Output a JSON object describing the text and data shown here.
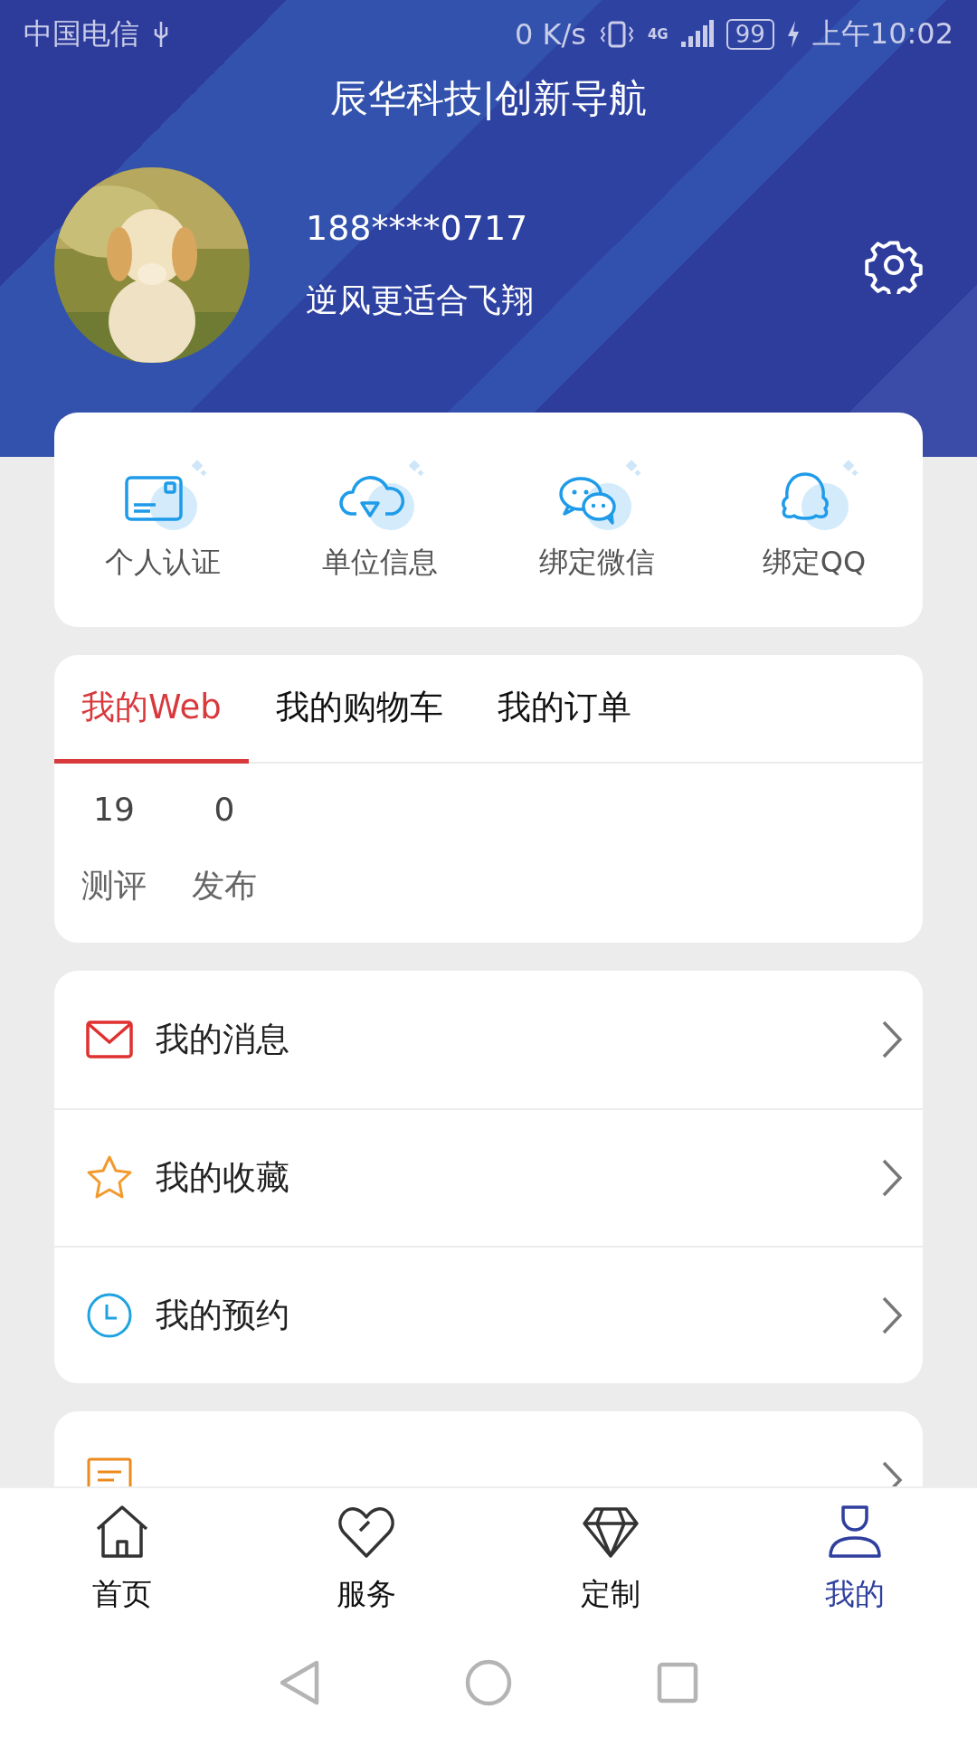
{
  "status_bar": {
    "carrier": "中国电信",
    "speed": "0 K/s",
    "network": "4G",
    "battery": "99",
    "time": "上午10:02"
  },
  "title": "辰华科技|创新导航",
  "profile": {
    "phone": "188****0717",
    "motto": "逆风更适合飞翔"
  },
  "quick_actions": [
    {
      "label": "个人认证",
      "kind": "card"
    },
    {
      "label": "单位信息",
      "kind": "cloud"
    },
    {
      "label": "绑定微信",
      "kind": "chat"
    },
    {
      "label": "绑定QQ",
      "kind": "penguin"
    }
  ],
  "tabs": [
    {
      "label": "我的Web",
      "selected": true
    },
    {
      "label": "我的购物车",
      "selected": false
    },
    {
      "label": "我的订单",
      "selected": false
    }
  ],
  "stats": [
    {
      "value": "19",
      "label": "测评"
    },
    {
      "value": "0",
      "label": "发布"
    }
  ],
  "menu": [
    {
      "label": "我的消息",
      "kind": "mail"
    },
    {
      "label": "我的收藏",
      "kind": "star"
    },
    {
      "label": "我的预约",
      "kind": "clock"
    }
  ],
  "menu_2": [
    {
      "kind": "invoice"
    }
  ],
  "bottom_nav": [
    {
      "label": "首页",
      "kind": "home",
      "selected": false
    },
    {
      "label": "服务",
      "kind": "heart",
      "selected": false
    },
    {
      "label": "定制",
      "kind": "diamond",
      "selected": false
    },
    {
      "label": "我的",
      "kind": "person",
      "selected": true
    }
  ]
}
